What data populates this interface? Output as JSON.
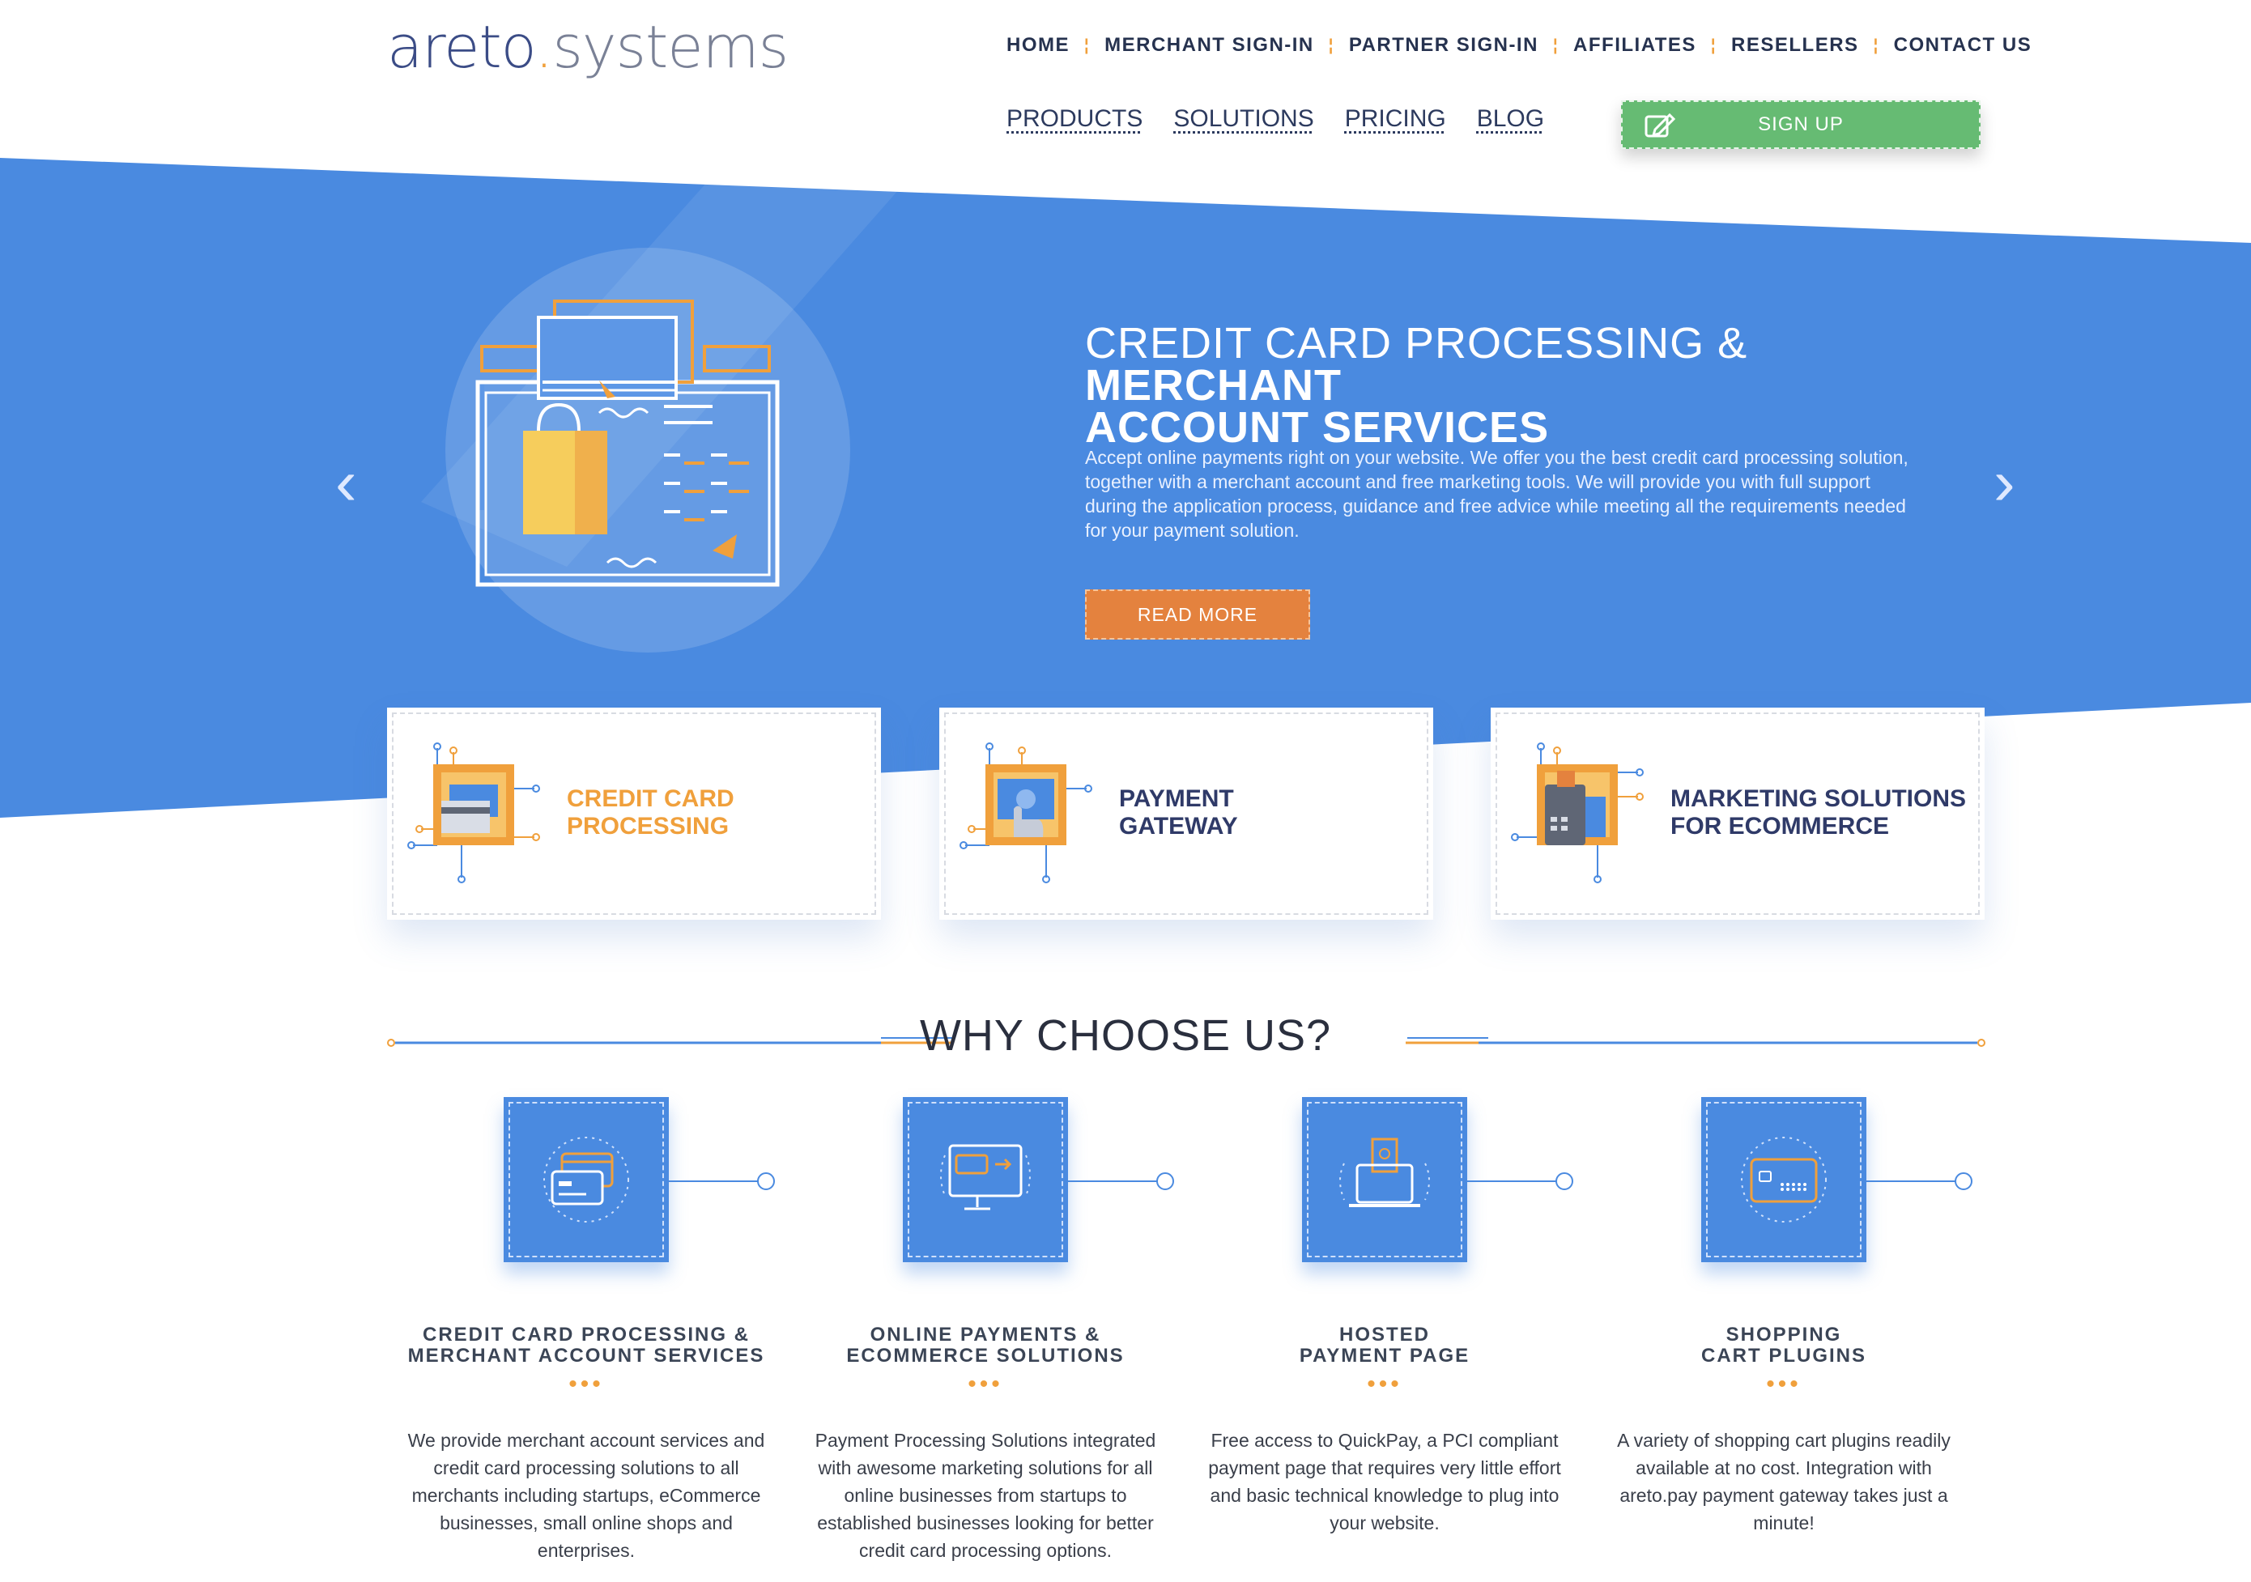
{
  "brand": {
    "part1": "areto",
    "dot": ".",
    "part2": "systems"
  },
  "top_nav": [
    "HOME",
    "MERCHANT SIGN-IN",
    "PARTNER SIGN-IN",
    "AFFILIATES",
    "RESELLERS",
    "CONTACT US"
  ],
  "sub_nav": [
    "PRODUCTS",
    "SOLUTIONS",
    "PRICING",
    "BLOG"
  ],
  "signup_label": "SIGN UP",
  "hero": {
    "title_light": "CREDIT CARD PROCESSING & ",
    "title_bold_1": "MERCHANT",
    "title_bold_2": "ACCOUNT SERVICES",
    "text": "Accept online payments right on your website. We offer you the best credit card processing solution, together with a merchant account and free marketing tools. We will provide you with full support during the application process, guidance and free advice while meeting all the requirements needed for your payment solution.",
    "button": "READ MORE",
    "prev": "‹",
    "next": "›"
  },
  "cards": [
    {
      "line1": "CREDIT CARD",
      "line2": "PROCESSING"
    },
    {
      "line1": "PAYMENT",
      "line2": "GATEWAY"
    },
    {
      "line1": "MARKETING SOLUTIONS",
      "line2": "FOR ECOMMERCE"
    }
  ],
  "why_title": "WHY CHOOSE US?",
  "features": [
    {
      "title1": "CREDIT CARD PROCESSING &",
      "title2": "MERCHANT ACCOUNT SERVICES",
      "dots": "•••",
      "text": "We provide merchant account services and credit card processing solutions to all merchants including startups, eCommerce businesses, small online shops and enterprises."
    },
    {
      "title1": "ONLINE PAYMENTS &",
      "title2": "ECOMMERCE SOLUTIONS",
      "dots": "•••",
      "text": "Payment Processing Solutions integrated with awesome marketing solutions for all online businesses from startups to established businesses looking for better credit card processing options."
    },
    {
      "title1": "HOSTED",
      "title2": "PAYMENT PAGE",
      "dots": "•••",
      "text": "Free access to QuickPay, a PCI compliant payment page that requires very little effort and basic technical knowledge to plug into your website."
    },
    {
      "title1": "SHOPPING",
      "title2": "CART PLUGINS",
      "dots": "•••",
      "text": "A variety of shopping cart plugins readily available at no cost. Integration with areto.pay payment gateway takes just a minute!"
    }
  ],
  "colors": {
    "primary_blue": "#4a8ae0",
    "orange": "#f0a03c",
    "green": "#66bb73",
    "navy": "#26324f"
  }
}
